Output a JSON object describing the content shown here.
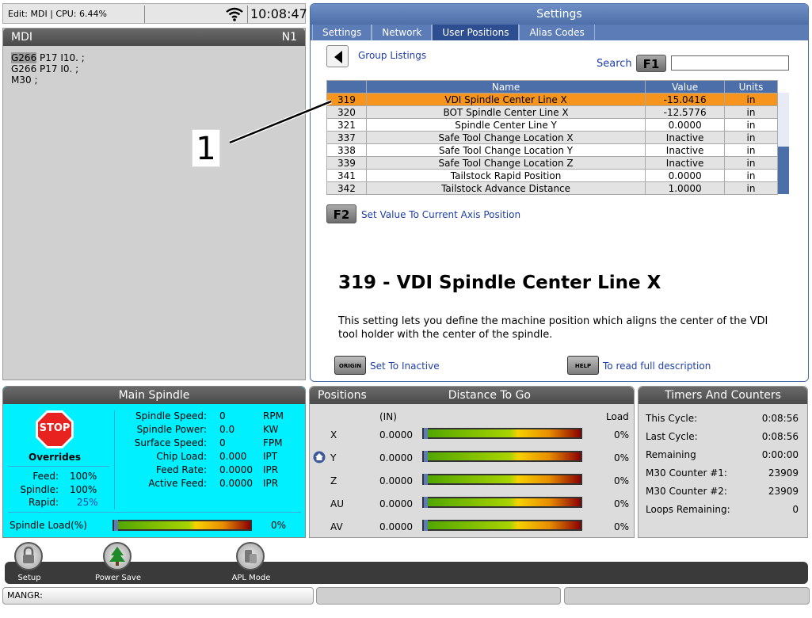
{
  "status": {
    "label": "Edit: MDI | CPU: 6.44%",
    "time": "10:08:47"
  },
  "mdi": {
    "title": "MDI",
    "line_no": "N1",
    "hl": "G266",
    "line1_rest": " P17 I10. ;",
    "line2": "G266 P17 I0. ;",
    "line3": "M30 ;"
  },
  "settings": {
    "title": "Settings",
    "tabs": [
      "Settings",
      "Network",
      "User Positions",
      "Alias Codes"
    ],
    "group_listings": "Group Listings",
    "search_label": "Search",
    "f1": "F1",
    "headers": [
      "",
      "Name",
      "Value",
      "Units"
    ],
    "rows": [
      {
        "num": "319",
        "name": "VDI Spindle Center Line X",
        "value": "-15.0416",
        "units": "in"
      },
      {
        "num": "320",
        "name": "BOT Spindle Center Line X",
        "value": "-12.5776",
        "units": "in"
      },
      {
        "num": "321",
        "name": "Spindle Center Line Y",
        "value": "0.0000",
        "units": "in"
      },
      {
        "num": "337",
        "name": "Safe Tool Change Location X",
        "value": "Inactive",
        "units": "in"
      },
      {
        "num": "338",
        "name": "Safe Tool Change Location Y",
        "value": "Inactive",
        "units": "in"
      },
      {
        "num": "339",
        "name": "Safe Tool Change Location Z",
        "value": "Inactive",
        "units": "in"
      },
      {
        "num": "341",
        "name": "Tailstock Rapid Position",
        "value": "0.0000",
        "units": "in"
      },
      {
        "num": "342",
        "name": "Tailstock Advance Distance",
        "value": "1.0000",
        "units": "in"
      }
    ],
    "f2": "F2",
    "f2_label": "Set Value To Current Axis Position",
    "desc_title": "319 - VDI Spindle Center Line X",
    "desc_text": "This setting lets you define the machine position which aligns the center of the VDI tool holder with the center of the spindle.",
    "origin_key": "ORIGIN",
    "origin_label": "Set To Inactive",
    "help_key": "HELP",
    "help_label": "To read full description"
  },
  "callout": "1",
  "spindle": {
    "title": "Main Spindle",
    "stop": "STOP",
    "overrides": "Overrides",
    "feed_lbl": "Feed:",
    "feed": "100%",
    "spindle_lbl": "Spindle:",
    "spindle": "100%",
    "rapid_lbl": "Rapid:",
    "rapid": "25%",
    "stats": [
      {
        "label": "Spindle Speed:",
        "value": "0",
        "unit": "RPM"
      },
      {
        "label": "Spindle Power:",
        "value": "0.0",
        "unit": "KW"
      },
      {
        "label": "Surface Speed:",
        "value": "0",
        "unit": "FPM"
      },
      {
        "label": "Chip Load:",
        "value": "0.000",
        "unit": "IPT"
      },
      {
        "label": "Feed Rate:",
        "value": "0.0000",
        "unit": "IPR"
      },
      {
        "label": "Active Feed:",
        "value": "0.0000",
        "unit": "IPR"
      }
    ],
    "load_lbl": "Spindle Load(%)",
    "load": "0%"
  },
  "positions": {
    "title": "Positions",
    "subtitle": "Distance To Go",
    "unit": "(IN)",
    "load": "Load",
    "axes": [
      {
        "axis": "X",
        "value": "0.0000",
        "load": "0%"
      },
      {
        "axis": "Y",
        "value": "0.0000",
        "load": "0%"
      },
      {
        "axis": "Z",
        "value": "0.0000",
        "load": "0%"
      },
      {
        "axis": "AU",
        "value": "0.0000",
        "load": "0%"
      },
      {
        "axis": "AV",
        "value": "0.0000",
        "load": "0%"
      }
    ]
  },
  "timers": {
    "title": "Timers And Counters",
    "rows": [
      {
        "label": "This Cycle:",
        "value": "0:08:56"
      },
      {
        "label": "Last Cycle:",
        "value": "0:08:56"
      },
      {
        "label": "Remaining",
        "value": "0:00:00"
      },
      {
        "label": "M30 Counter #1:",
        "value": "23909"
      },
      {
        "label": "M30 Counter #2:",
        "value": "23909"
      },
      {
        "label": "Loops Remaining:",
        "value": "0"
      }
    ]
  },
  "bottom": {
    "setup": "Setup",
    "power": "Power Save",
    "apl": "APL Mode",
    "cmd": "MANGR:"
  }
}
